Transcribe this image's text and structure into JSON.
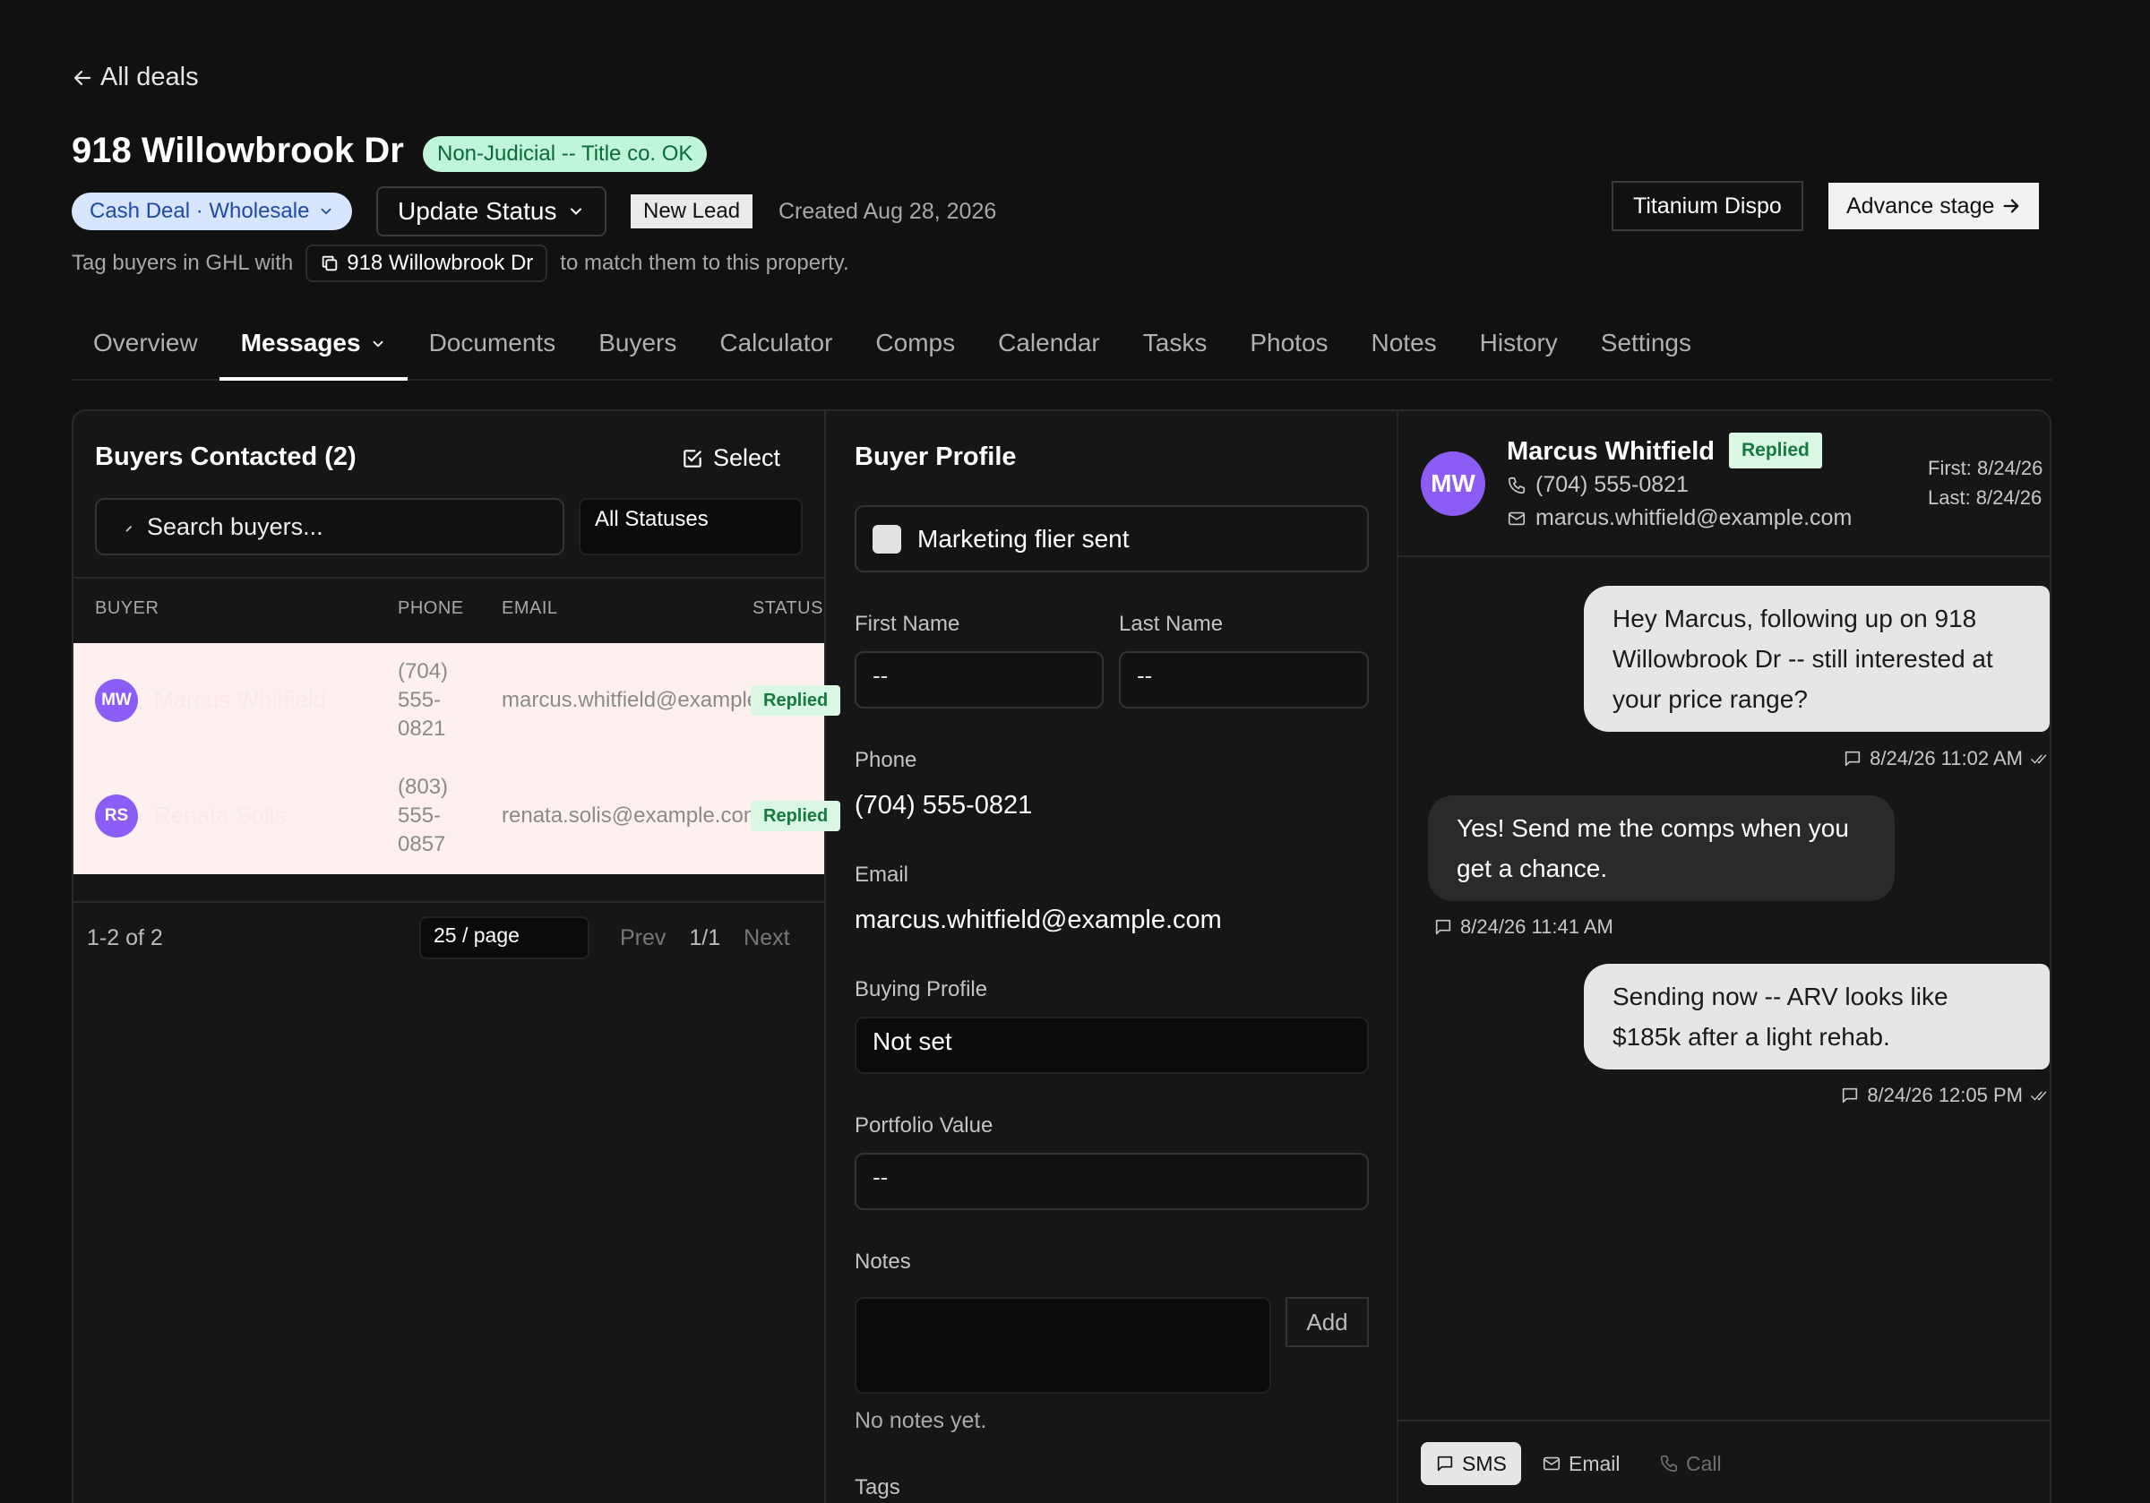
{
  "header": {
    "back_label": "All deals",
    "title": "918 Willowbrook Dr",
    "judicial_badge": "Non-Judicial -- Title co. OK",
    "deal_type": "Cash Deal · Wholesale",
    "update_status": "Update Status",
    "stage_badge": "New Lead",
    "created": "Created Aug 28, 2026",
    "titanium_button": "Titanium Dispo",
    "advance_button": "Advance stage",
    "tag_prefix": "Tag buyers in GHL with",
    "tag_value": "918 Willowbrook Dr",
    "tag_suffix": "to match them to this property."
  },
  "tabs": [
    "Overview",
    "Messages",
    "Documents",
    "Buyers",
    "Calculator",
    "Comps",
    "Calendar",
    "Tasks",
    "Photos",
    "Notes",
    "History",
    "Settings"
  ],
  "active_tab": "Messages",
  "buyers_panel": {
    "title": "Buyers Contacted (2)",
    "select_label": "Select",
    "search_placeholder": "Search buyers...",
    "status_filter": "All Statuses",
    "columns": [
      "BUYER",
      "PHONE",
      "EMAIL",
      "STATUS"
    ],
    "rows": [
      {
        "initials": "MW",
        "name": "Marcus Whitfield",
        "phone_lines": [
          "(704)",
          "555-",
          "0821"
        ],
        "email": "marcus.whitfield@example.com",
        "status": "Replied"
      },
      {
        "initials": "RS",
        "name": "Renata Solis",
        "phone_lines": [
          "(803)",
          "555-",
          "0857"
        ],
        "email": "renata.solis@example.com",
        "status": "Replied"
      }
    ],
    "count": "1-2 of 2",
    "per_page": "25 / page",
    "prev": "Prev",
    "page": "1/1",
    "next": "Next"
  },
  "profile": {
    "title": "Buyer Profile",
    "flier_label": "Marketing flier sent",
    "flier_checked": false,
    "first_name_label": "First Name",
    "first_name_value": "--",
    "last_name_label": "Last Name",
    "last_name_value": "--",
    "phone_label": "Phone",
    "phone_value": "(704) 555-0821",
    "email_label": "Email",
    "email_value": "marcus.whitfield@example.com",
    "buying_profile_label": "Buying Profile",
    "buying_profile_value": "Not set",
    "portfolio_label": "Portfolio Value",
    "portfolio_value": "--",
    "notes_label": "Notes",
    "add_button": "Add",
    "no_notes": "No notes yet.",
    "tags_label": "Tags"
  },
  "conversation": {
    "initials": "MW",
    "name": "Marcus Whitfield",
    "status": "Replied",
    "phone": "(704) 555-0821",
    "email": "marcus.whitfield@example.com",
    "first_contact": "First: 8/24/26",
    "last_contact": "Last: 8/24/26",
    "messages": [
      {
        "direction": "out",
        "text": "Hey Marcus, following up on 918 Willowbrook Dr -- still interested at your price range?",
        "time": "8/24/26 11:02 AM"
      },
      {
        "direction": "in",
        "text": "Yes! Send me the comps when you get a chance.",
        "time": "8/24/26 11:41 AM"
      },
      {
        "direction": "out",
        "text": "Sending now -- ARV looks like $185k after a light rehab.",
        "time": "8/24/26 12:05 PM"
      }
    ],
    "channels": [
      "SMS",
      "Email",
      "Call"
    ],
    "active_channel": "SMS"
  },
  "colors": {
    "background": "#111111",
    "panel": "#161616",
    "avatar": "#8b5cf6",
    "replied_bg": "#d9f7e3",
    "replied_fg": "#167a3e",
    "selected_row": "#fff0f0"
  },
  "icons": {
    "back": "arrow-left-icon",
    "chevron": "chevron-down-icon",
    "copy": "copy-icon",
    "select": "checkbox-icon",
    "search": "search-icon",
    "phone": "phone-icon",
    "mail": "mail-icon",
    "chat": "chat-icon",
    "read": "double-check-icon",
    "arrow_right": "arrow-right-icon"
  }
}
